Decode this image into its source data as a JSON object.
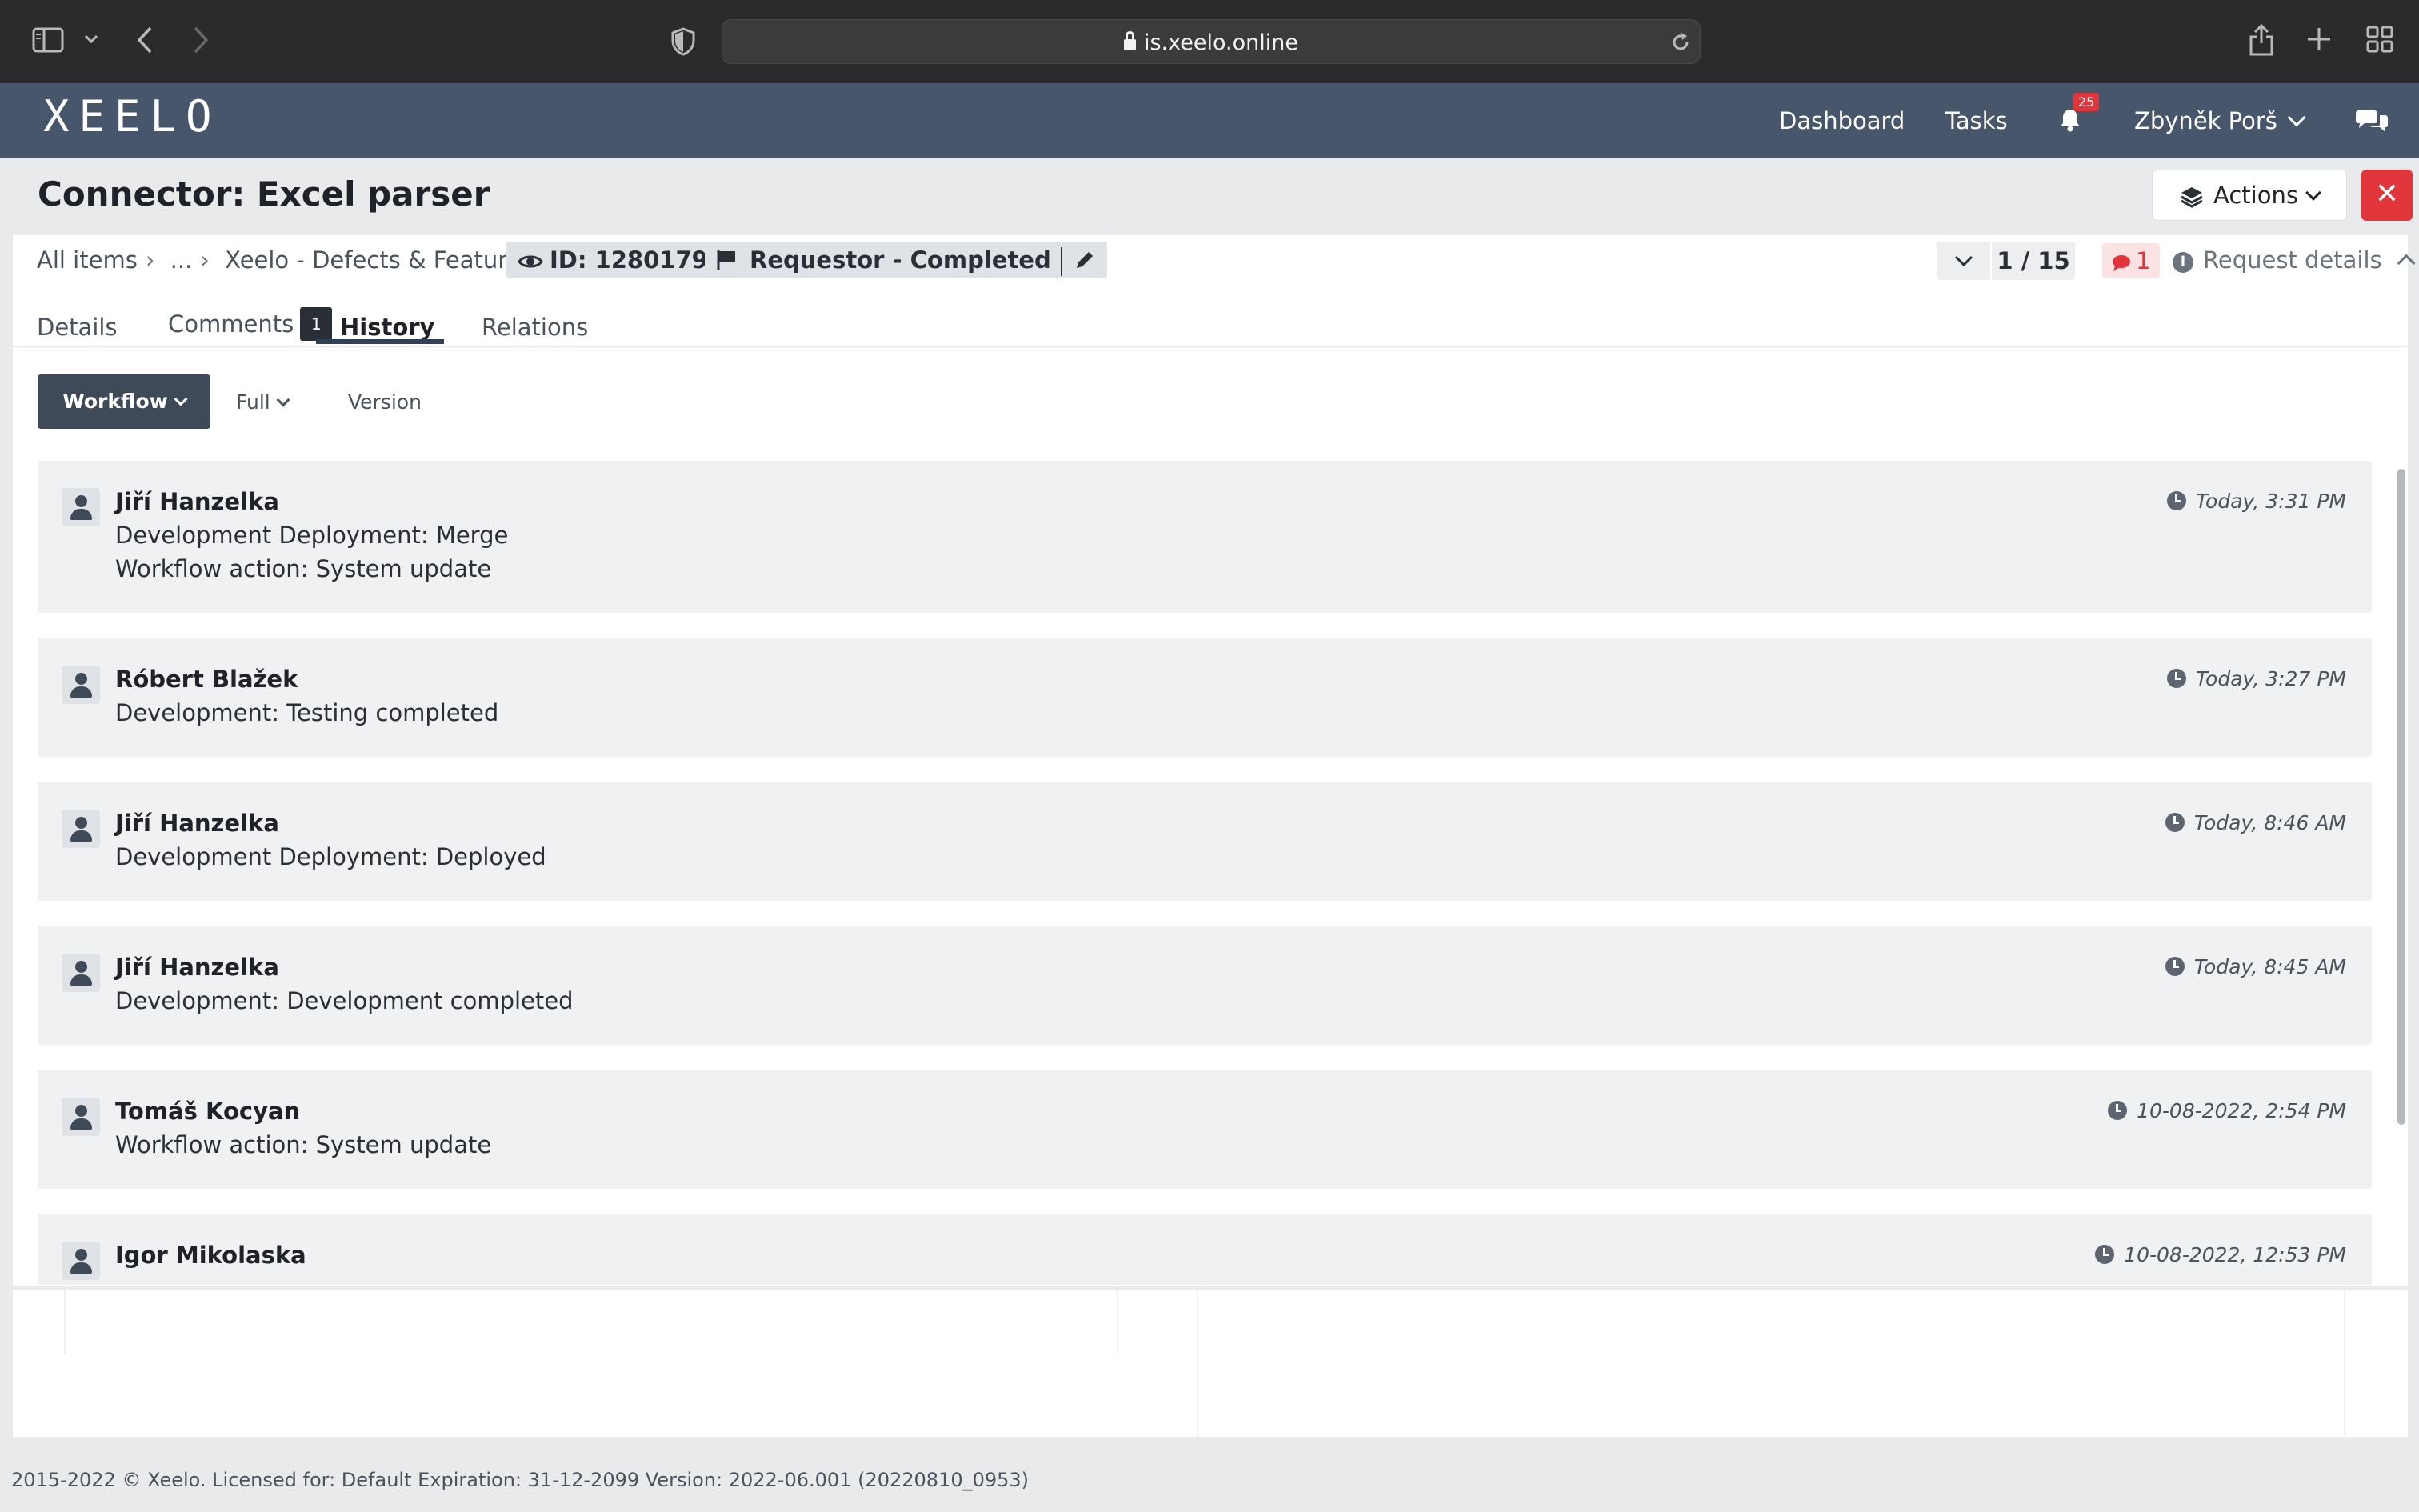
{
  "browser": {
    "url": "is.xeelo.online"
  },
  "nav": {
    "logo": "XEELO",
    "links": [
      "Dashboard",
      "Tasks"
    ],
    "notification_count": "25",
    "user_name": "Zbyněk Porš"
  },
  "page": {
    "title": "Connector: Excel parser",
    "actions_label": "Actions",
    "close_label": "✕"
  },
  "breadcrumb": {
    "items": [
      "All items",
      "...",
      "Xeelo - Defects & Features"
    ],
    "id_label": "ID: 1280179",
    "state_label": "Requestor - Completed"
  },
  "pager": {
    "position": "1 / 15",
    "message_count": "1",
    "request_details_label": "Request details"
  },
  "tabs": [
    {
      "label": "Details"
    },
    {
      "label": "Comments",
      "count": "1"
    },
    {
      "label": "History",
      "active": true
    },
    {
      "label": "Relations"
    }
  ],
  "filters": {
    "workflow_label": "Workflow",
    "full_label": "Full",
    "version_label": "Version"
  },
  "history": [
    {
      "user": "Jiří Hanzelka",
      "lines": [
        "Development Deployment: Merge",
        "Workflow action: System update"
      ],
      "time": "Today, 3:31 PM"
    },
    {
      "user": "Róbert Blažek",
      "lines": [
        "Development: Testing completed"
      ],
      "time": "Today, 3:27 PM"
    },
    {
      "user": "Jiří Hanzelka",
      "lines": [
        "Development Deployment: Deployed"
      ],
      "time": "Today, 8:46 AM"
    },
    {
      "user": "Jiří Hanzelka",
      "lines": [
        "Development: Development completed"
      ],
      "time": "Today, 8:45 AM"
    },
    {
      "user": "Tomáš Kocyan",
      "lines": [
        "Workflow action: System update"
      ],
      "time": "10-08-2022, 2:54 PM"
    },
    {
      "user": "Igor Mikolaska",
      "lines": [],
      "time": "10-08-2022, 12:53 PM"
    }
  ],
  "footer": {
    "text": "2015-2022 © Xeelo. Licensed for: Default Expiration: 31-12-2099 Version: 2022-06.001 (20220810_0953)"
  }
}
